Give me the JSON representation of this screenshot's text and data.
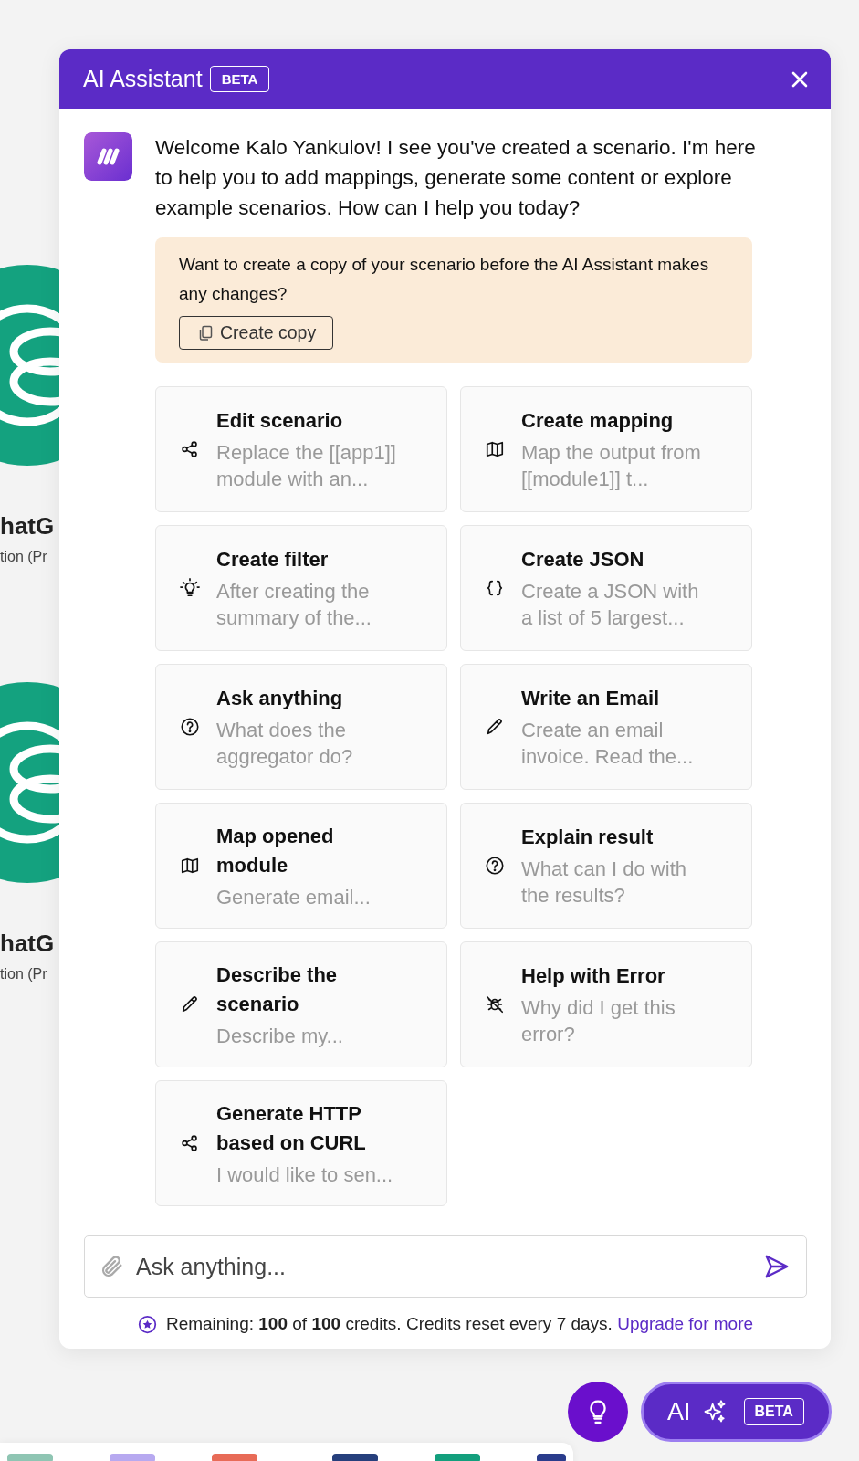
{
  "canvas": {
    "nodes": [
      {
        "name": "hatG",
        "subtitle": "tion (Pr"
      },
      {
        "name": "hatG",
        "subtitle": "tion (Pr"
      }
    ]
  },
  "header": {
    "title": "AI Assistant",
    "badge": "BETA"
  },
  "message": {
    "text": "Welcome Kalo Yankulov! I see you've created a scenario. I'm here to help you to add mappings, generate some content or explore example scenarios. How can I help you today?"
  },
  "notice": {
    "text": "Want to create a copy of your scenario before the AI Assistant makes any changes?",
    "button": "Create copy"
  },
  "suggestions": [
    {
      "kind": "share",
      "title": "Edit scenario",
      "description": "Replace the [[app1]] module with an..."
    },
    {
      "kind": "map",
      "title": "Create mapping",
      "description": "Map the output from [[module1]] t..."
    },
    {
      "kind": "bulb",
      "title": "Create filter",
      "description": "After creating the summary of the..."
    },
    {
      "kind": "braces",
      "title": "Create JSON",
      "description": "Create a JSON with a list of 5 largest..."
    },
    {
      "kind": "help",
      "title": "Ask anything",
      "description": "What does the aggregator do?"
    },
    {
      "kind": "pencil",
      "title": "Write an Email",
      "description": "Create an email invoice. Read the..."
    },
    {
      "kind": "map",
      "title": "Map opened module",
      "description": "Generate email..."
    },
    {
      "kind": "help",
      "title": "Explain result",
      "description": "What can I do with the results?"
    },
    {
      "kind": "pencil",
      "title": "Describe the scenario",
      "description": "Describe my..."
    },
    {
      "kind": "bug",
      "title": "Help with Error",
      "description": "Why did I get this error?"
    },
    {
      "kind": "share",
      "title": "Generate HTTP based on CURL",
      "description": "I would like to sen..."
    }
  ],
  "composer": {
    "placeholder": "Ask anything..."
  },
  "credits": {
    "text": "Remaining: **100** of **100** credits. Credits reset every 7 days.",
    "link": "Upgrade for more"
  },
  "launcher": {
    "label": "AI",
    "badge": "BETA"
  }
}
